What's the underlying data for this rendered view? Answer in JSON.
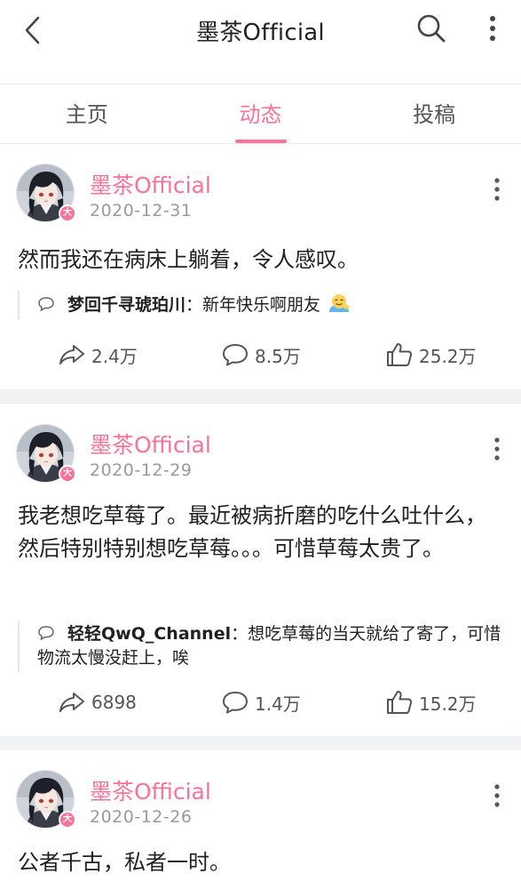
{
  "header": {
    "title": "墨茶Official"
  },
  "tabs": [
    {
      "label": "主页"
    },
    {
      "label": "动态"
    },
    {
      "label": "投稿"
    }
  ],
  "posts": [
    {
      "author": "墨茶Official",
      "date": "2020-12-31",
      "text": "然而我还在病床上躺着，令人感叹。",
      "reply": {
        "user": "梦回千寻琥珀川",
        "sep": "：",
        "text": "新年快乐啊朋友"
      },
      "shares": "2.4万",
      "comments": "8.5万",
      "likes": "25.2万"
    },
    {
      "author": "墨茶Official",
      "date": "2020-12-29",
      "text": "我老想吃草莓了。最近被病折磨的吃什么吐什么，然后特别特别想吃草莓。。。可惜草莓太贵了。",
      "reply": {
        "user": "轻轻QwQ_Channel",
        "sep": "：",
        "text": "想吃草莓的当天就给了寄了，可惜物流太慢没赶上，唉"
      },
      "shares": "6898",
      "comments": "1.4万",
      "likes": "15.2万"
    },
    {
      "author": "墨茶Official",
      "date": "2020-12-26",
      "text": "公者千古，私者一时。"
    }
  ],
  "badge": "大",
  "colors": {
    "accent": "#fb7299",
    "text": "#212121",
    "muted": "#9a9a9a",
    "divider": "#f1f2f3"
  },
  "icons": [
    "back-icon",
    "search-icon",
    "more-icon",
    "share-icon",
    "comment-icon",
    "like-icon",
    "reply-bubble-icon",
    "smile-emoji-icon"
  ]
}
